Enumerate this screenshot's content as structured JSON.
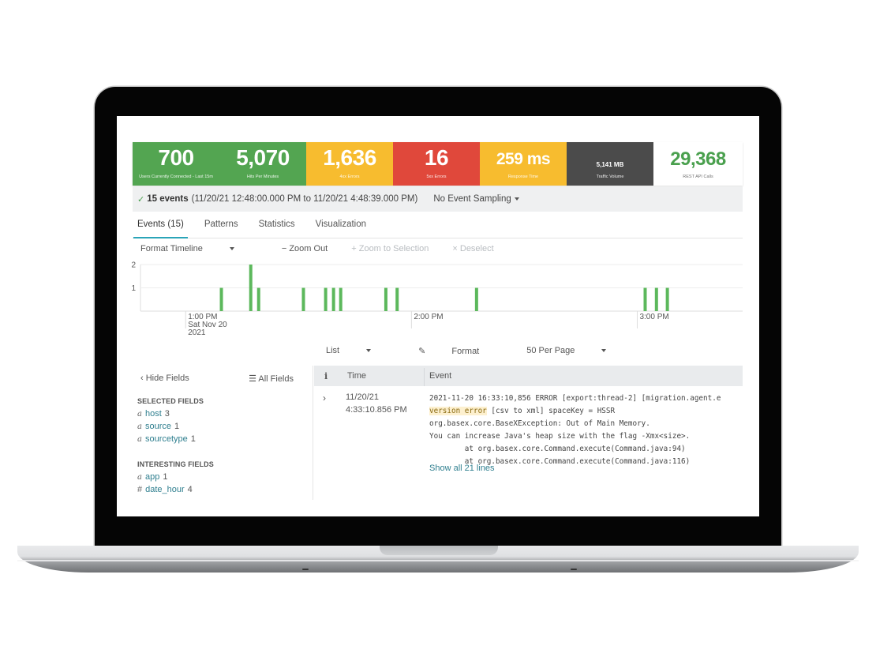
{
  "kpis": [
    {
      "value": "700",
      "label": "Users Currently Connected - Last 15m",
      "color": "#53a551"
    },
    {
      "value": "5,070",
      "label": "Hits Per Minutes",
      "color": "#53a551"
    },
    {
      "value": "1,636",
      "label": "4xx Errors",
      "color": "#f7bc2f"
    },
    {
      "value": "16",
      "label": "5xx Errors",
      "color": "#e0483b"
    },
    {
      "value": "259 ms",
      "label": "Response Time",
      "color": "#f7bc2f"
    },
    {
      "value": "5,141 MB",
      "label": "Traffic Volume",
      "color": "#4b4b4b"
    },
    {
      "value": "29,368",
      "label": "REST API Calls",
      "color": "#ffffff",
      "text_color": "#4aa04e"
    }
  ],
  "summary": {
    "check_icon": "✓",
    "count": "15 events",
    "range": "(11/20/21 12:48:00.000 PM to 11/20/21 4:48:39.000 PM)",
    "sampling": "No Event Sampling"
  },
  "tabs": [
    {
      "label": "Events (15)",
      "active": true
    },
    {
      "label": "Patterns",
      "active": false
    },
    {
      "label": "Statistics",
      "active": false
    },
    {
      "label": "Visualization",
      "active": false
    }
  ],
  "timeline_toolbar": {
    "format": "Format Timeline",
    "zoom_out": "− Zoom Out",
    "zoom_selection": "+ Zoom to Selection",
    "deselect": "× Deselect"
  },
  "chart_data": {
    "type": "bar",
    "title": "",
    "xlabel": "",
    "ylabel": "",
    "ylim": [
      0,
      2
    ],
    "yticks": [
      "1",
      "2"
    ],
    "x_unit": "minutes after 1:00 PM",
    "xlim": [
      -12,
      148
    ],
    "xticks": [
      {
        "at": 0,
        "lines": [
          "1:00 PM",
          "Sat Nov 20",
          "2021"
        ]
      },
      {
        "at": 60,
        "lines": [
          "2:00 PM"
        ]
      },
      {
        "at": 120,
        "lines": [
          "3:00 PM"
        ]
      }
    ],
    "x": [
      9.5,
      17.3,
      19.4,
      31.3,
      37.2,
      39.3,
      41.2,
      53.2,
      56.2,
      77.3,
      122.1,
      125.1,
      128.0
    ],
    "values": [
      1,
      2,
      1,
      1,
      1,
      1,
      1,
      1,
      1,
      1,
      1,
      1,
      1
    ],
    "bar_color": "#5cb85c",
    "grid": true
  },
  "list_controls": {
    "list": "List",
    "format": "Format",
    "per_page": "50 Per Page"
  },
  "fields": {
    "hide": "‹ Hide Fields",
    "all": "All Fields",
    "selected_title": "SELECTED FIELDS",
    "selected": [
      {
        "type": "a",
        "name": "host",
        "count": "3"
      },
      {
        "type": "a",
        "name": "source",
        "count": "1"
      },
      {
        "type": "a",
        "name": "sourcetype",
        "count": "1"
      }
    ],
    "interesting_title": "INTERESTING FIELDS",
    "interesting": [
      {
        "type": "a",
        "name": "app",
        "count": "1"
      },
      {
        "type": "#",
        "name": "date_hour",
        "count": "4"
      }
    ]
  },
  "events_table": {
    "headers": {
      "info": "i",
      "time": "Time",
      "event": "Event"
    },
    "rows": [
      {
        "date": "11/20/21",
        "time": "4:33:10.856 PM",
        "line1": "2021-11-20 16:33:10,856 ERROR [export:thread-2] [migration.agent.e",
        "line2_highlight": "version error",
        "line2_rest": " [csv to xml] spaceKey = HSSR",
        "line3": "org.basex.core.BaseXException: Out of Main Memory.",
        "line4": "You can increase Java's heap size with the flag -Xmx<size>.",
        "line5": "        at org.basex.core.Command.execute(Command.java:94)",
        "line6": "        at org.basex.core.Command.execute(Command.java:116)",
        "show_all": "Show all 21 lines"
      }
    ]
  }
}
